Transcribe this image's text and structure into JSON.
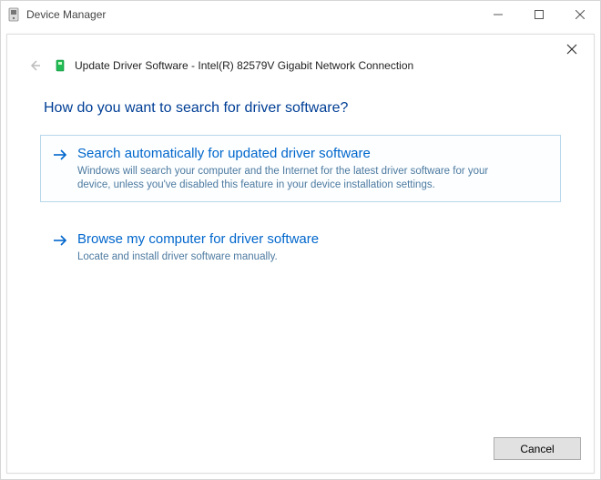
{
  "outer": {
    "title": "Device Manager"
  },
  "header": {
    "prefix": "Update Driver Software -",
    "device": "Intel(R) 82579V Gigabit Network Connection"
  },
  "question": "How do you want to search for driver software?",
  "options": [
    {
      "title": "Search automatically for updated driver software",
      "desc": "Windows will search your computer and the Internet for the latest driver software for your device, unless you've disabled this feature in your device installation settings."
    },
    {
      "title": "Browse my computer for driver software",
      "desc": "Locate and install driver software manually."
    }
  ],
  "buttons": {
    "cancel": "Cancel"
  }
}
